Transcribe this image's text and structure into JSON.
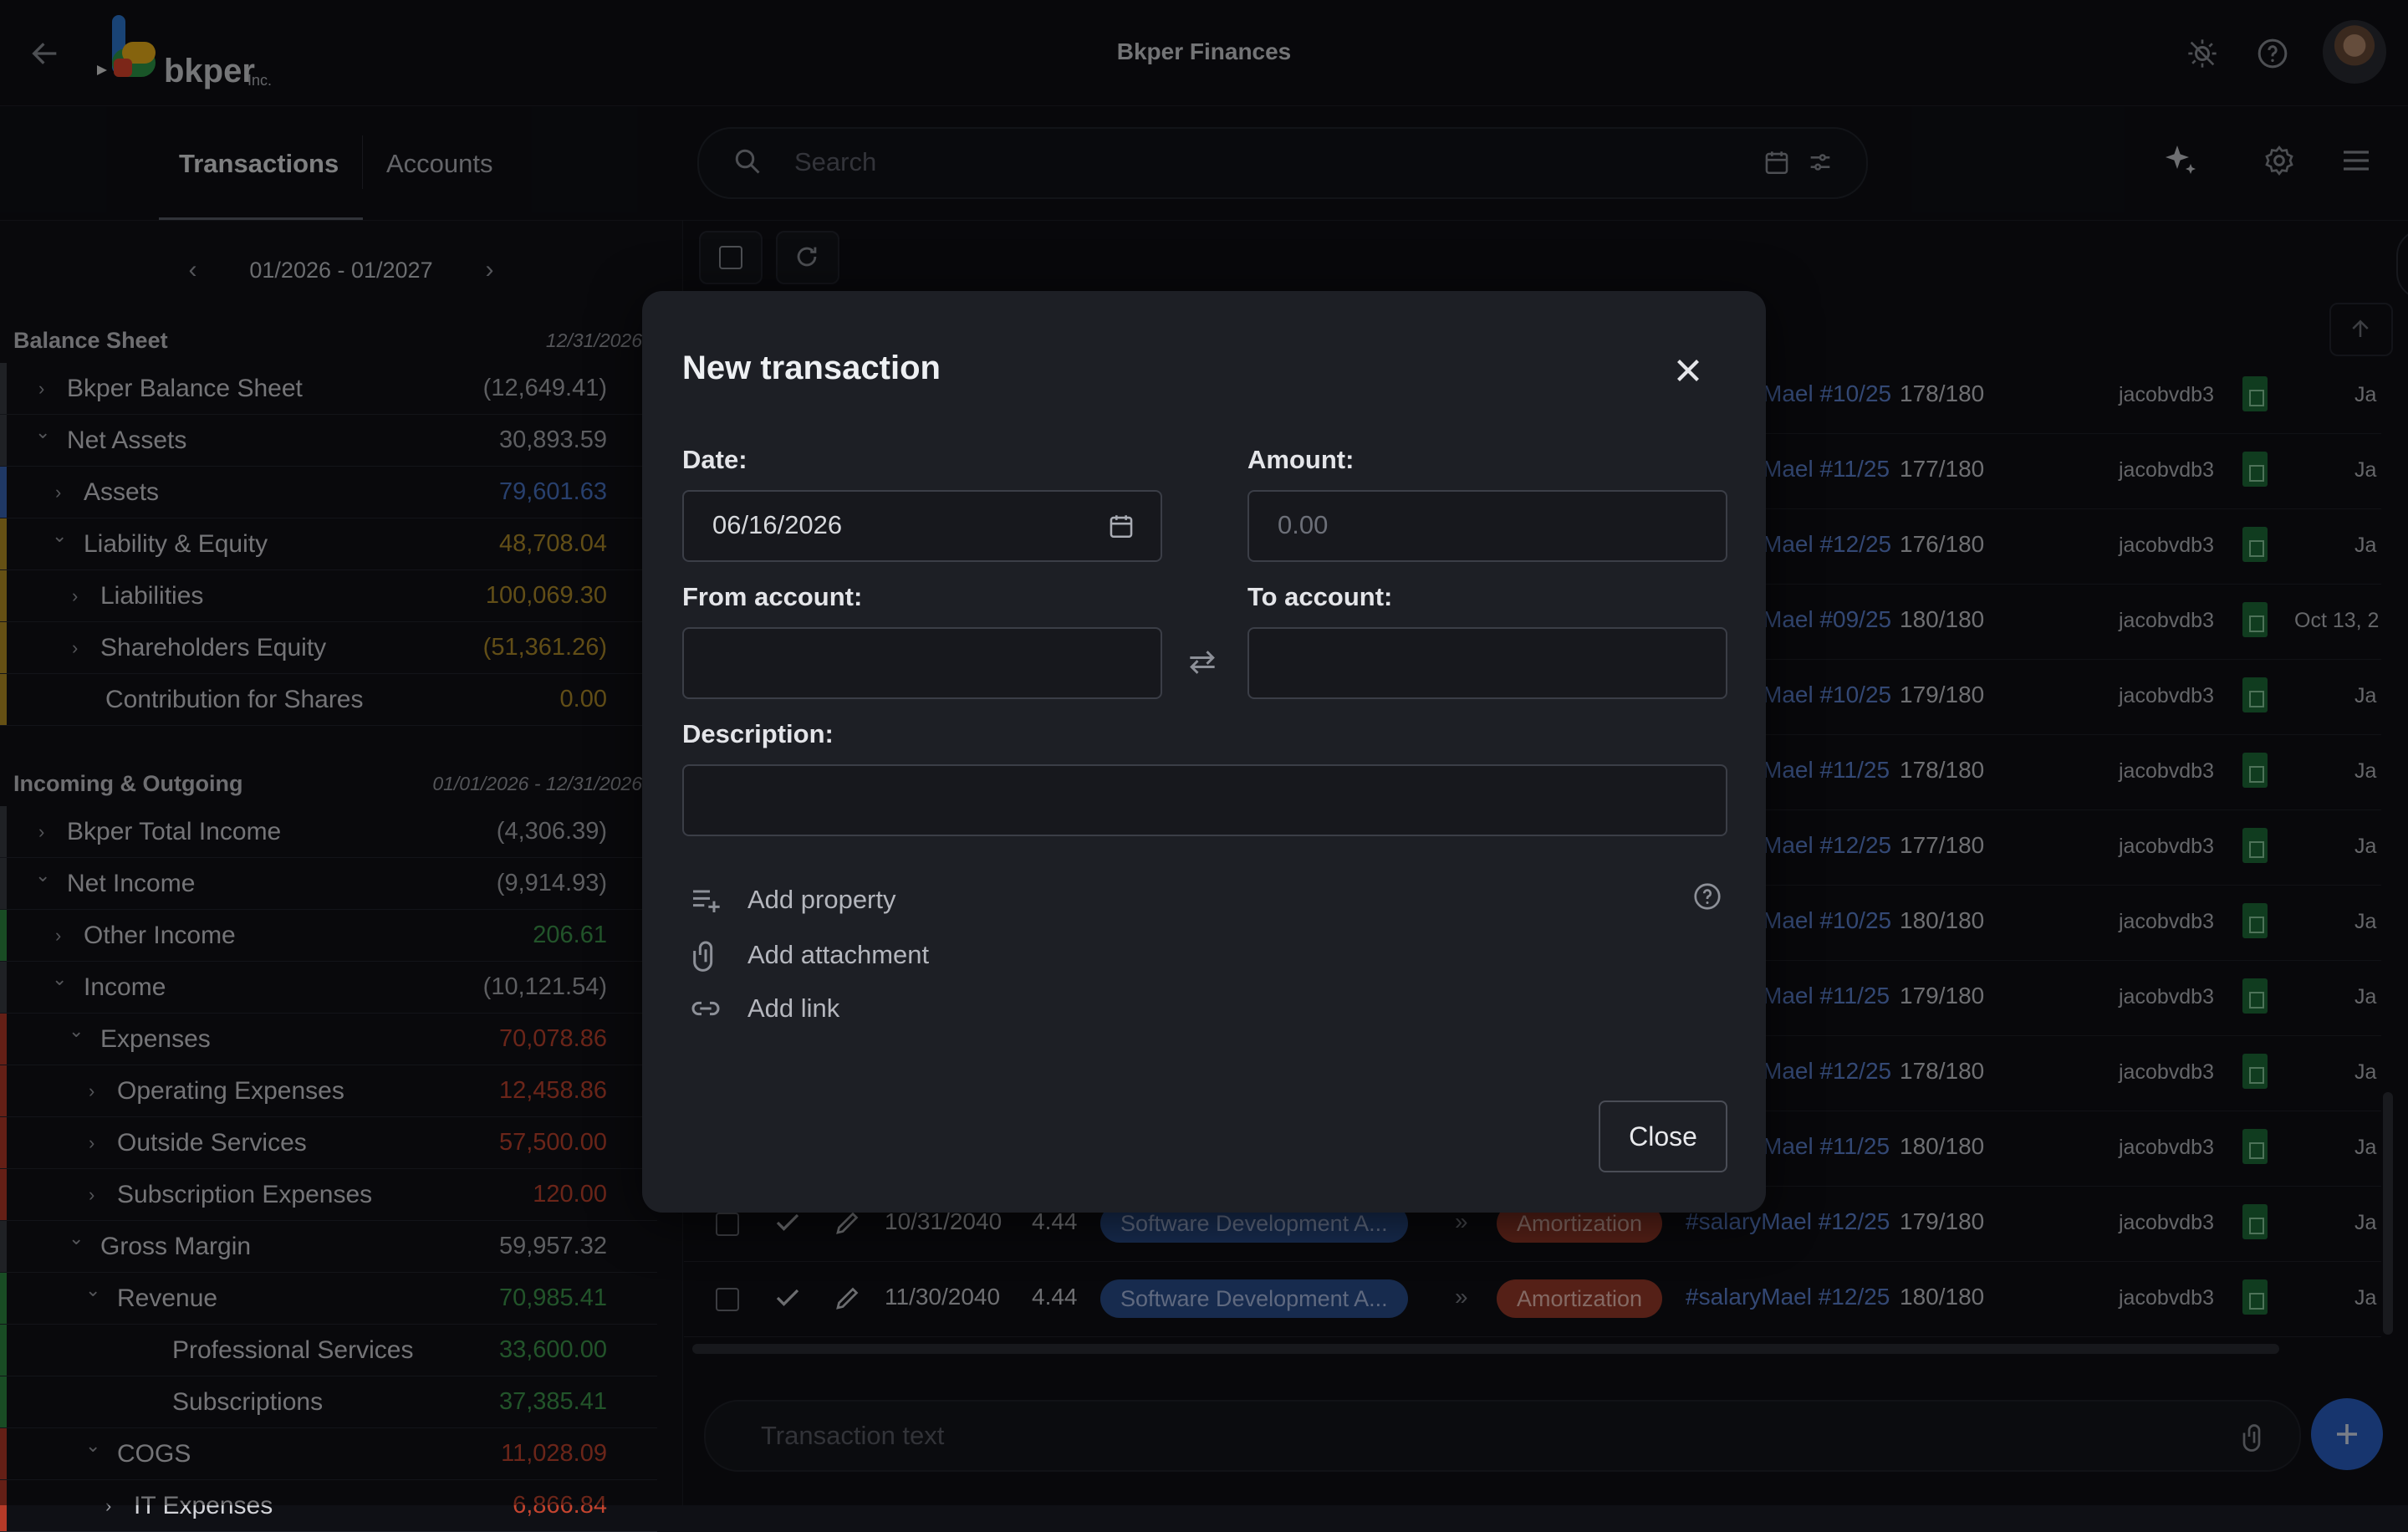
{
  "app": {
    "title": "Bkper Finances",
    "company": "bkper Inc."
  },
  "tabs": {
    "transactions": "Transactions",
    "accounts": "Accounts"
  },
  "search": {
    "placeholder": "Search"
  },
  "left_panel": {
    "period": "01/2026 - 01/2027",
    "balance_sheet": {
      "title": "Balance Sheet",
      "date": "12/31/2026",
      "rows": [
        {
          "label": "Bkper Balance Sheet",
          "value": "(12,649.41)",
          "color": "#a9abb1"
        },
        {
          "label": "Net Assets",
          "value": "30,893.59",
          "color": "#a9abb1"
        },
        {
          "label": "Assets",
          "value": "79,601.63",
          "color": "#4a76c9"
        },
        {
          "label": "Liability & Equity",
          "value": "48,708.04",
          "color": "#b38f2a"
        },
        {
          "label": "Liabilities",
          "value": "100,069.30",
          "color": "#b38f2a"
        },
        {
          "label": "Shareholders Equity",
          "value": "(51,361.26)",
          "color": "#b38f2a"
        },
        {
          "label": "Contribution for Shares",
          "value": "0.00",
          "color": "#b38f2a"
        }
      ]
    },
    "incoming_outgoing": {
      "title": "Incoming & Outgoing",
      "date": "01/01/2026 - 12/31/2026",
      "rows": [
        {
          "label": "Bkper Total Income",
          "value": "(4,306.39)",
          "color": "#a9abb1"
        },
        {
          "label": "Net Income",
          "value": "(9,914.93)",
          "color": "#a9abb1"
        },
        {
          "label": "Other Income",
          "value": "206.61",
          "color": "#3f9a4e"
        },
        {
          "label": "Income",
          "value": "(10,121.54)",
          "color": "#a9abb1"
        },
        {
          "label": "Expenses",
          "value": "70,078.86",
          "color": "#c4442f"
        },
        {
          "label": "Operating Expenses",
          "value": "12,458.86",
          "color": "#c4442f"
        },
        {
          "label": "Outside Services",
          "value": "57,500.00",
          "color": "#c4442f"
        },
        {
          "label": "Subscription Expenses",
          "value": "120.00",
          "color": "#c4442f"
        },
        {
          "label": "Gross Margin",
          "value": "59,957.32",
          "color": "#a9abb1"
        },
        {
          "label": "Revenue",
          "value": "70,985.41",
          "color": "#3f9a4e"
        },
        {
          "label": "Professional Services",
          "value": "33,600.00",
          "color": "#3f9a4e"
        },
        {
          "label": "Subscriptions",
          "value": "37,385.41",
          "color": "#3f9a4e"
        },
        {
          "label": "COGS",
          "value": "11,028.09",
          "color": "#c4442f"
        },
        {
          "label": "IT Expenses",
          "value": "6,866.84",
          "color": "#c4442f"
        }
      ]
    }
  },
  "table": {
    "rows": [
      {
        "desc": "Mael #10/25",
        "count": "178/180",
        "user": "jacobvdb3",
        "date": "Ja"
      },
      {
        "desc": "Mael #11/25",
        "count": "177/180",
        "user": "jacobvdb3",
        "date": "Ja"
      },
      {
        "desc": "Mael #12/25",
        "count": "176/180",
        "user": "jacobvdb3",
        "date": "Ja"
      },
      {
        "desc": "Mael #09/25",
        "count": "180/180",
        "user": "jacobvdb3",
        "date": "Oct 13, 2"
      },
      {
        "desc": "Mael #10/25",
        "count": "179/180",
        "user": "jacobvdb3",
        "date": "Ja"
      },
      {
        "desc": "Mael #11/25",
        "count": "178/180",
        "user": "jacobvdb3",
        "date": "Ja"
      },
      {
        "desc": "Mael #12/25",
        "count": "177/180",
        "user": "jacobvdb3",
        "date": "Ja"
      },
      {
        "desc": "Mael #10/25",
        "count": "180/180",
        "user": "jacobvdb3",
        "date": "Ja"
      },
      {
        "desc": "Mael #11/25",
        "count": "179/180",
        "user": "jacobvdb3",
        "date": "Ja"
      },
      {
        "desc": "Mael #12/25",
        "count": "178/180",
        "user": "jacobvdb3",
        "date": "Ja"
      },
      {
        "desc": "Mael #11/25",
        "count": "180/180",
        "user": "jacobvdb3",
        "date": "Ja"
      }
    ],
    "full_rows": [
      {
        "date": "10/31/2040",
        "amount": "4.44",
        "from": "Software Development A...",
        "to": "Amortization",
        "desc": "#salaryMael #12/25",
        "count": "179/180",
        "user": "jacobvdb3",
        "dt": "Ja"
      },
      {
        "date": "11/30/2040",
        "amount": "4.44",
        "from": "Software Development A...",
        "to": "Amortization",
        "desc": "#salaryMael #12/25",
        "count": "180/180",
        "user": "jacobvdb3",
        "dt": "Ja"
      }
    ]
  },
  "composer": {
    "placeholder": "Transaction text"
  },
  "modal": {
    "title": "New transaction",
    "date_label": "Date:",
    "date_value": "06/16/2026",
    "amount_label": "Amount:",
    "amount_placeholder": "0.00",
    "from_label": "From account:",
    "to_label": "To account:",
    "description_label": "Description:",
    "add_property": "Add property",
    "add_attachment": "Add attachment",
    "add_link": "Add link",
    "close_button": "Close"
  },
  "icons": {
    "back": "arrow-left-icon",
    "theme": "brightness-icon",
    "help": "help-circle-icon",
    "search": "search-icon",
    "calendar": "calendar-icon",
    "filter": "filter-icon",
    "ai": "sparkle-icon",
    "settings": "gear-icon",
    "menu": "menu-icon"
  }
}
